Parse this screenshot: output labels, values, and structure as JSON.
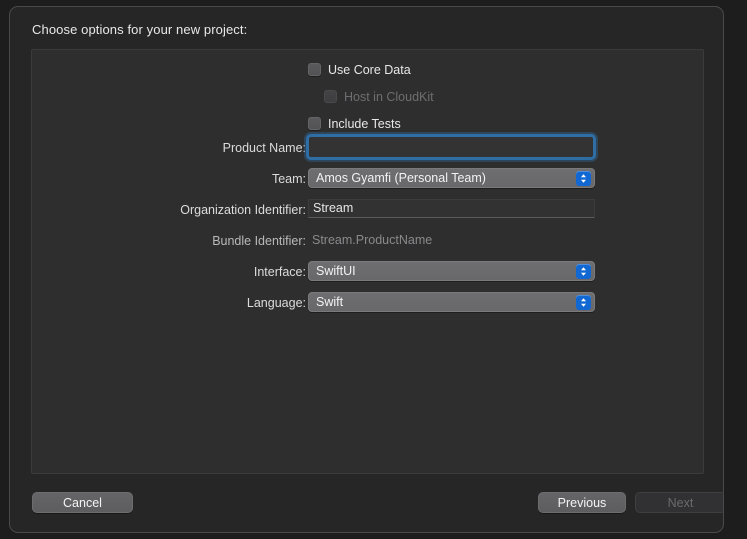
{
  "dialog": {
    "title": "Choose options for your new project:"
  },
  "form": {
    "rows": [
      {
        "label": "Product Name:",
        "type": "textfield-focused",
        "value": "",
        "placeholder": "",
        "name": "product-name"
      },
      {
        "label": "Team:",
        "type": "popup",
        "value": "Amos Gyamfi (Personal Team)",
        "name": "team"
      },
      {
        "label": "Organization Identifier:",
        "type": "textfield",
        "value": "Stream",
        "name": "organization-identifier"
      },
      {
        "label": "Bundle Identifier:",
        "type": "static",
        "value": "Stream.ProductName",
        "name": "bundle-identifier"
      },
      {
        "label": "Interface:",
        "type": "popup",
        "value": "SwiftUI",
        "name": "interface"
      },
      {
        "label": "Language:",
        "type": "popup",
        "value": "Swift",
        "name": "language"
      }
    ],
    "checkboxes": [
      {
        "label": "Use Core Data",
        "checked": false,
        "disabled": false,
        "indent": false,
        "name": "use-core-data"
      },
      {
        "label": "Host in CloudKit",
        "checked": false,
        "disabled": true,
        "indent": true,
        "name": "host-in-cloudkit"
      },
      {
        "label": "Include Tests",
        "checked": false,
        "disabled": false,
        "indent": false,
        "name": "include-tests"
      }
    ]
  },
  "buttons": {
    "cancel": "Cancel",
    "previous": "Previous",
    "next": "Next"
  },
  "icons": {
    "popup_chevron": "chevron-up-down-icon"
  },
  "colors": {
    "window_background": "#262627",
    "panel_background": "#2e2e2f",
    "accent_blue": "#1268d3",
    "focus_ring": "#2f6ea5",
    "text_primary": "#e8e8e8",
    "text_disabled": "#6e6e70",
    "popup_fill": "#6e6e70"
  }
}
